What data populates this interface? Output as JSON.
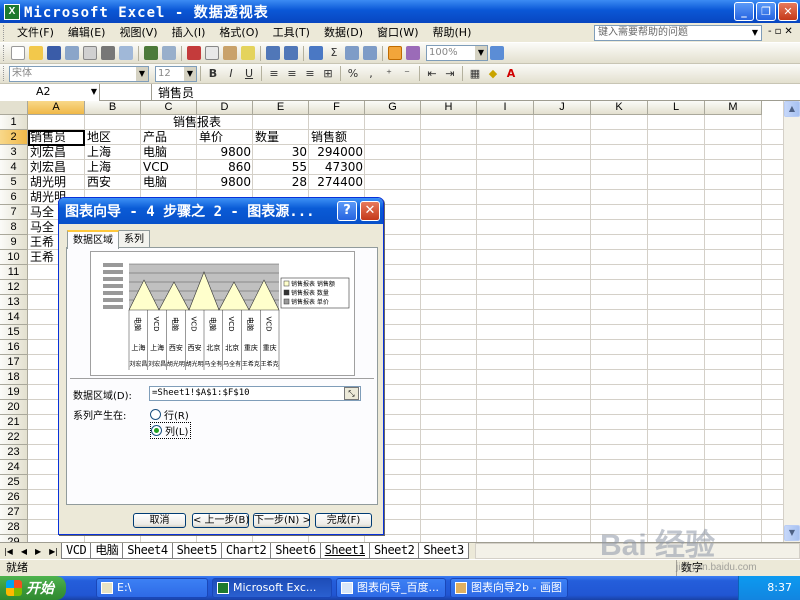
{
  "window": {
    "title": "Microsoft Excel - 数据透视表",
    "app_icon": "excel-icon"
  },
  "menu": [
    "文件(F)",
    "编辑(E)",
    "视图(V)",
    "插入(I)",
    "格式(O)",
    "工具(T)",
    "数据(D)",
    "窗口(W)",
    "帮助(H)"
  ],
  "help_placeholder": "键入需要帮助的问题",
  "toolbar": {
    "zoom": "100%",
    "font": "宋体",
    "font_size": "12",
    "bold": "B",
    "italic": "I",
    "underline": "U"
  },
  "formula_bar": {
    "name_box": "A2",
    "content": "销售员"
  },
  "columns": [
    "A",
    "B",
    "C",
    "D",
    "E",
    "F",
    "G",
    "H",
    "I",
    "J",
    "K",
    "L",
    "M"
  ],
  "rows": [
    "1",
    "2",
    "3",
    "4",
    "5",
    "6",
    "7",
    "8",
    "9",
    "10",
    "11",
    "12",
    "13",
    "14",
    "15",
    "16",
    "17",
    "18",
    "19",
    "20",
    "21",
    "22",
    "23",
    "24",
    "25",
    "26",
    "27",
    "28",
    "29"
  ],
  "sheet": {
    "title": "销售报表",
    "headers": [
      "销售员",
      "地区",
      "产品",
      "单价",
      "数量",
      "销售额"
    ],
    "rows": [
      [
        "刘宏昌",
        "上海",
        "电脑",
        "9800",
        "30",
        "294000"
      ],
      [
        "刘宏昌",
        "上海",
        "VCD",
        "860",
        "55",
        "47300"
      ],
      [
        "胡光明",
        "西安",
        "电脑",
        "9800",
        "28",
        "274400"
      ],
      [
        "胡光明",
        "",
        "",
        "",
        "",
        ""
      ],
      [
        "马全",
        "",
        "",
        "",
        "",
        ""
      ],
      [
        "马全",
        "",
        "",
        "",
        "",
        ""
      ],
      [
        "王希",
        "",
        "",
        "",
        "",
        ""
      ],
      [
        "王希",
        "",
        "",
        "",
        "",
        ""
      ]
    ]
  },
  "sheet_tabs": [
    "VCD",
    "电脑",
    "Sheet4",
    "Sheet5",
    "Chart2",
    "Sheet6",
    "Sheet1",
    "Sheet2",
    "Sheet3"
  ],
  "active_sheet": "Sheet1",
  "status": {
    "left": "就绪",
    "right": "数字"
  },
  "dialog": {
    "title": "图表向导 - 4 步骤之 2 - 图表源...",
    "tabs": [
      "数据区域",
      "系列"
    ],
    "range_label": "数据区域(D):",
    "range_value": "=Sheet1!$A$1:$F$10",
    "series_in_label": "系列产生在:",
    "option_row": "行(R)",
    "option_col": "列(L)",
    "buttons": {
      "cancel": "取消",
      "back": "< 上一步(B)",
      "next": "下一步(N) >",
      "finish": "完成(F)"
    }
  },
  "preview": {
    "legend": [
      "销售报表 销售额",
      "销售报表 数量",
      "销售报表 单价"
    ],
    "categories": [
      "上海",
      "上海",
      "西安",
      "西安",
      "北京",
      "北京",
      "重庆",
      "重庆"
    ],
    "people": [
      "刘宏昌",
      "刘宏昌",
      "胡光明",
      "胡光明",
      "马全有",
      "马全有",
      "王希克",
      "王希克"
    ],
    "products": [
      "电脑",
      "VCD",
      "电脑",
      "VCD",
      "电脑",
      "VCD",
      "电脑",
      "VCD"
    ]
  },
  "taskbar": {
    "start": "开始",
    "tasks": [
      "E:\\",
      "Microsoft Exc...",
      "图表向导_百度...",
      "图表向导2b - 画图"
    ],
    "clock": "8:37"
  },
  "watermark": {
    "brand": "Bai 经验",
    "site": "jingyan.baidu.com"
  }
}
